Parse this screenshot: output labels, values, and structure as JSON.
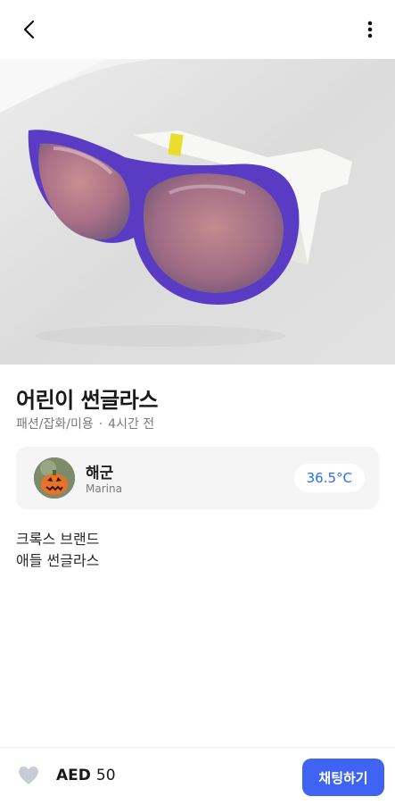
{
  "header": {
    "back_icon": "chevron-left-icon",
    "more_icon": "more-vertical-icon"
  },
  "product": {
    "title": "어린이 썬글라스",
    "category": "패션/잡화/미용",
    "separator": "·",
    "time": "4시간 전",
    "photo_label": "purple kids sunglasses photo",
    "description_lines": [
      "크록스 브랜드",
      "애들 썬글라스"
    ]
  },
  "seller": {
    "name": "해군",
    "location": "Marina",
    "temperature": "36.5°C",
    "temperature_color": "#2b6df0"
  },
  "footer": {
    "currency": "AED",
    "price": "50",
    "chat_label": "채팅하기",
    "like_icon": "heart-icon",
    "accent": "#3f63f2"
  }
}
